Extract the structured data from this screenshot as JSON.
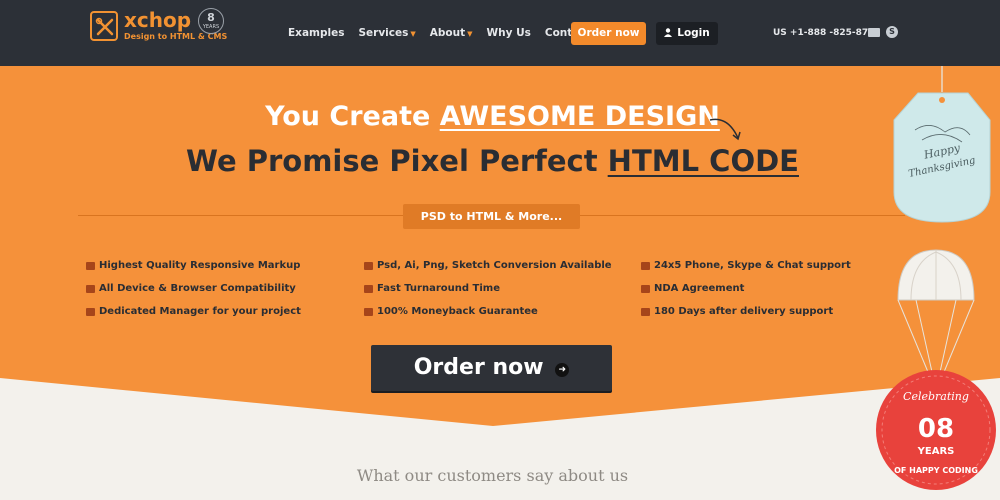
{
  "brand": {
    "name": "xchop",
    "tagline": "Design to HTML & CMS",
    "years_badge_number": "8",
    "years_badge_label": "YEARS"
  },
  "nav": {
    "items": [
      {
        "label": "Examples",
        "dropdown": false
      },
      {
        "label": "Services",
        "dropdown": true
      },
      {
        "label": "About",
        "dropdown": true
      },
      {
        "label": "Why Us",
        "dropdown": false
      },
      {
        "label": "Contact",
        "dropdown": false
      }
    ],
    "order_button": "Order now",
    "login_button": "Login",
    "phone": "US +1-888 -825-8745"
  },
  "hero": {
    "line1_prefix": "You Create ",
    "line1_highlight": "AWESOME DESIGN",
    "line2_prefix": "We Promise Pixel Perfect ",
    "line2_highlight": "HTML CODE",
    "pill": "PSD to HTML & More...",
    "features": [
      [
        "Highest Quality Responsive Markup",
        "All Device & Browser Compatibility",
        "Dedicated Manager for your project"
      ],
      [
        "Psd, Ai, Png, Sketch Conversion Available",
        "Fast Turnaround Time",
        "100% Moneyback Guarantee"
      ],
      [
        "24x5 Phone, Skype & Chat support",
        "NDA Agreement",
        "180 Days after delivery support"
      ]
    ],
    "cta": "Order now"
  },
  "decorations": {
    "tag_text_1": "Happy",
    "tag_text_2": "Thanksgiving",
    "balloon_celebrating": "Celebrating",
    "balloon_number": "08",
    "balloon_years": "YEARS",
    "balloon_bottom": "OF HAPPY CODING"
  },
  "section": {
    "customers_heading": "What our customers say about us"
  },
  "colors": {
    "nav_bg": "#2c3037",
    "accent": "#f38a2b",
    "hero_bg": "#f5913a",
    "page_bg": "#f3f1ec",
    "dark_text": "#2a2d33",
    "balloon_red": "#e8423c",
    "tag_mint": "#cfe9ea"
  }
}
